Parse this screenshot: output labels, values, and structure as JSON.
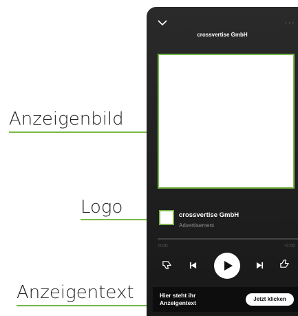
{
  "annotations": {
    "image_label": "Anzeigenbild",
    "logo_label": "Logo",
    "text_label": "Anzeigentext",
    "line_color": "#7ab648"
  },
  "player": {
    "title": "crossvertise GmbH",
    "artist": "crossvertise GmbH",
    "subtitle": "Advertisement",
    "time_elapsed": "0:00",
    "time_remaining": "-0:00",
    "icons": [
      "chevron-down-icon",
      "more-icon",
      "thumbs-down-icon",
      "previous-icon",
      "play-icon",
      "next-icon",
      "thumbs-up-icon"
    ],
    "ad_text": "Hier steht ihr Anzeigentext",
    "cta_label": "Jetzt klicken"
  }
}
